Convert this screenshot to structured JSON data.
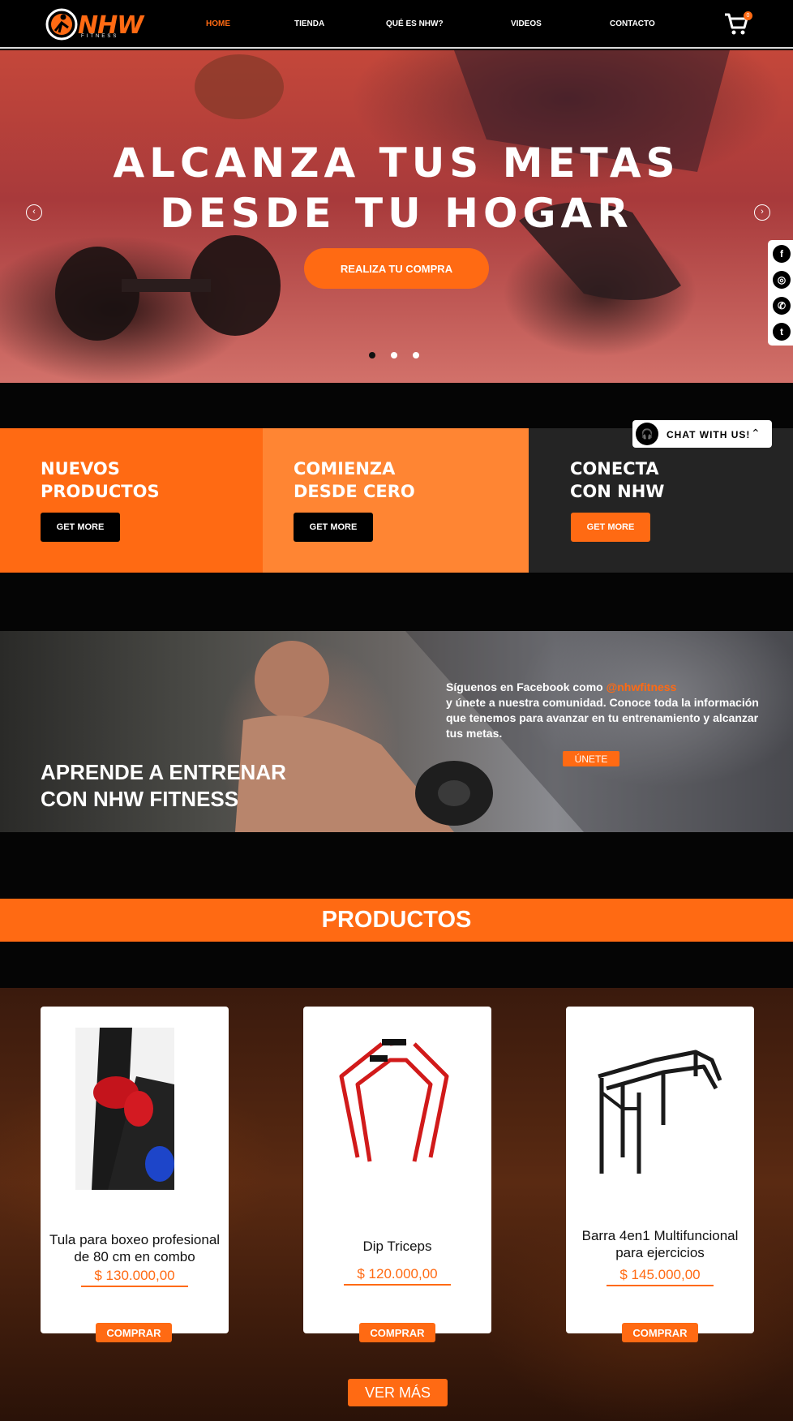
{
  "brand": {
    "name": "NHW",
    "tagline": "FITNESS"
  },
  "nav": {
    "items": [
      {
        "label": "HOME"
      },
      {
        "label": "TIENDA"
      },
      {
        "label": "QUÉ ES NHW?"
      },
      {
        "label": "VIDEOS"
      },
      {
        "label": "CONTACTO"
      }
    ],
    "active": "HOME",
    "cart_count": "0"
  },
  "hero": {
    "title_line1": "ALCANZA TUS METAS",
    "title_line2": "DESDE TU HOGAR",
    "button": "REALIZA TU COMPRA",
    "prev_icon": "chevron-left-icon",
    "next_icon": "chevron-right-icon",
    "slides": 3,
    "active_slide": 1
  },
  "social": {
    "icons": [
      "facebook-icon",
      "instagram-icon",
      "whatsapp-icon",
      "twitter-icon"
    ],
    "glyphs": [
      "f",
      "◎",
      "✆",
      "t"
    ]
  },
  "chat": {
    "label": "CHAT WITH US!",
    "icon": "headset-icon"
  },
  "features": [
    {
      "title_line1": "NUEVOS",
      "title_line2": "PRODUCTOS",
      "button": "GET MORE",
      "bg": "#ff6a13",
      "button_bg": "#000000"
    },
    {
      "title_line1": "COMIENZA",
      "title_line2": "DESDE CERO",
      "button": "GET MORE",
      "bg": "#ff8533",
      "button_bg": "#000000"
    },
    {
      "title_line1": "CONECTA",
      "title_line2": "CON NHW",
      "button": "GET MORE",
      "bg": "#242424",
      "button_bg": "#ff6a13"
    }
  ],
  "train": {
    "title_line1": "APRENDE A ENTRENAR",
    "title_line2": "CON NHW FITNESS",
    "text_prefix": "Síguenos en Facebook como ",
    "handle": "@nhwfitness",
    "text_body": "y únete a nuestra comunidad. Conoce toda la información que tenemos para avanzar en tu entrenamiento y alcanzar tus metas.",
    "button": "ÚNETE"
  },
  "products": {
    "heading": "PRODUCTOS",
    "items": [
      {
        "name": "Tula para boxeo profesional de 80 cm en combo",
        "price": "$ 130.000,00",
        "button": "COMPRAR"
      },
      {
        "name": "Dip Triceps",
        "price": "$ 120.000,00",
        "button": "COMPRAR"
      },
      {
        "name": "Barra 4en1 Multifuncional para ejercicios",
        "price": "$ 145.000,00",
        "button": "COMPRAR"
      }
    ],
    "more_button": "VER MÁS"
  },
  "colors": {
    "accent": "#ff6a13",
    "dark": "#050505",
    "panel": "#242424"
  }
}
